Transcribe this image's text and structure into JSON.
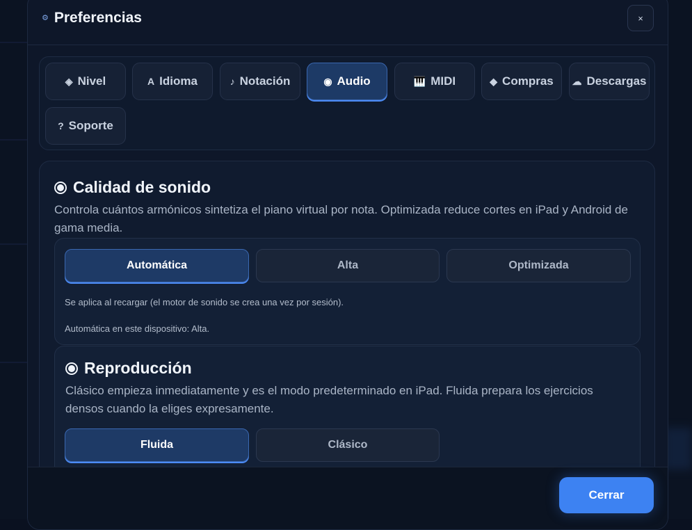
{
  "header": {
    "title": "Preferencias",
    "close_label": "×"
  },
  "tabs": [
    {
      "label": "Nivel",
      "icon": "◈",
      "icon_name": "diamond-icon",
      "active": false
    },
    {
      "label": "Idioma",
      "icon": "A",
      "icon_name": "language-icon",
      "active": false
    },
    {
      "label": "Notación",
      "icon": "♪",
      "icon_name": "music-note-icon",
      "active": false
    },
    {
      "label": "Audio",
      "icon": "◉",
      "icon_name": "radio-icon",
      "active": true
    },
    {
      "label": "MIDI",
      "icon": "🎹",
      "icon_name": "piano-icon",
      "active": false
    },
    {
      "label": "Compras",
      "icon": "◆",
      "icon_name": "diamond-small-icon",
      "active": false
    },
    {
      "label": "Descargas",
      "icon": "☁",
      "icon_name": "cloud-icon",
      "active": false
    },
    {
      "label": "Soporte",
      "icon": "?",
      "icon_name": "help-icon",
      "active": false
    }
  ],
  "quality": {
    "title": "Calidad de sonido",
    "description": "Controla cuántos armónicos sintetiza el piano virtual por nota. Optimizada reduce cortes en iPad y Android de gama media.",
    "options": [
      "Automática",
      "Alta",
      "Optimizada"
    ],
    "selected": "Automática",
    "note1": "Se aplica al recargar (el motor de sonido se crea una vez por sesión).",
    "note2": "Automática en este dispositivo: Alta."
  },
  "playback": {
    "title": "Reproducción",
    "description": "Clásico empieza inmediatamente y es el modo predeterminado en iPad. Fluida prepara los ejercicios densos cuando la eliges expresamente.",
    "options": [
      "Fluida",
      "Clásico"
    ],
    "selected": "Fluida"
  },
  "footer": {
    "close_button": "Cerrar"
  },
  "colors": {
    "accent": "#3d82f2",
    "active_tab": "#1d3a66",
    "background": "#0e1729"
  }
}
